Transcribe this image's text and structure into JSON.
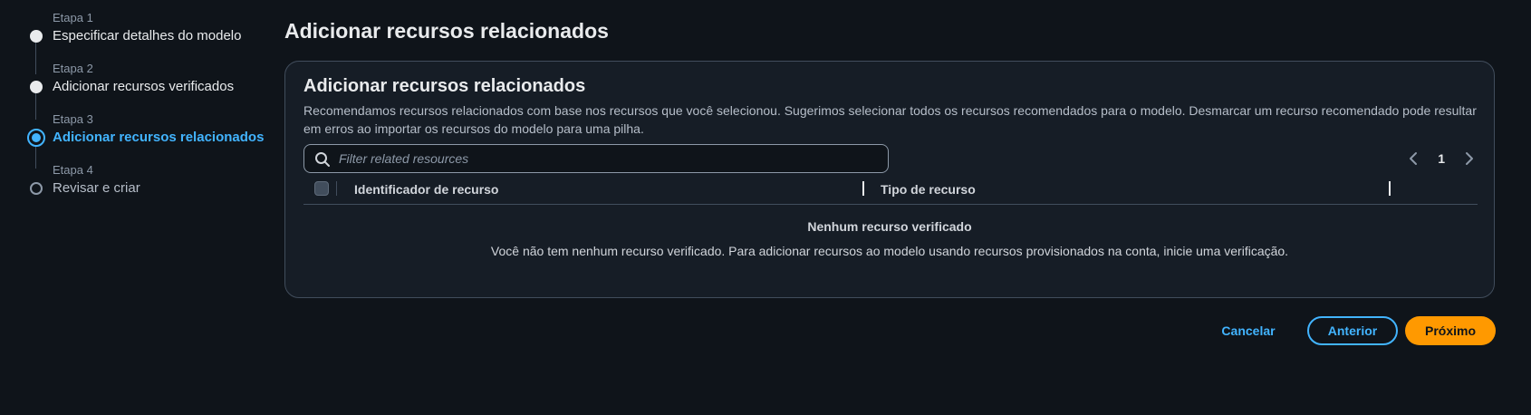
{
  "wizard": {
    "steps": [
      {
        "label": "Etapa 1",
        "title": "Especificar detalhes do modelo",
        "state": "completed"
      },
      {
        "label": "Etapa 2",
        "title": "Adicionar recursos verificados",
        "state": "completed"
      },
      {
        "label": "Etapa 3",
        "title": "Adicionar recursos relacionados",
        "state": "active"
      },
      {
        "label": "Etapa 4",
        "title": "Revisar e criar",
        "state": "upcoming"
      }
    ]
  },
  "page": {
    "title": "Adicionar recursos relacionados"
  },
  "container": {
    "title": "Adicionar recursos relacionados",
    "description": "Recomendamos recursos relacionados com base nos recursos que você selecionou. Sugerimos selecionar todos os recursos recomendados para o modelo. Desmarcar um recurso recomendado pode resultar em erros ao importar os recursos do modelo para uma pilha.",
    "search": {
      "placeholder": "Filter related resources",
      "value": ""
    },
    "pagination": {
      "current_page": "1"
    },
    "table": {
      "columns": [
        "Identificador de recurso",
        "Tipo de recurso"
      ],
      "rows": []
    },
    "empty_state": {
      "title": "Nenhum recurso verificado",
      "description": "Você não tem nenhum recurso verificado. Para adicionar recursos ao modelo usando recursos provisionados na conta, inicie uma verificação."
    }
  },
  "footer": {
    "cancel_label": "Cancelar",
    "previous_label": "Anterior",
    "next_label": "Próximo"
  },
  "colors": {
    "background": "#0f141a",
    "container_bg": "#161d26",
    "accent": "#42b4ff",
    "primary_button": "#ff9900",
    "border": "#414d5c"
  }
}
